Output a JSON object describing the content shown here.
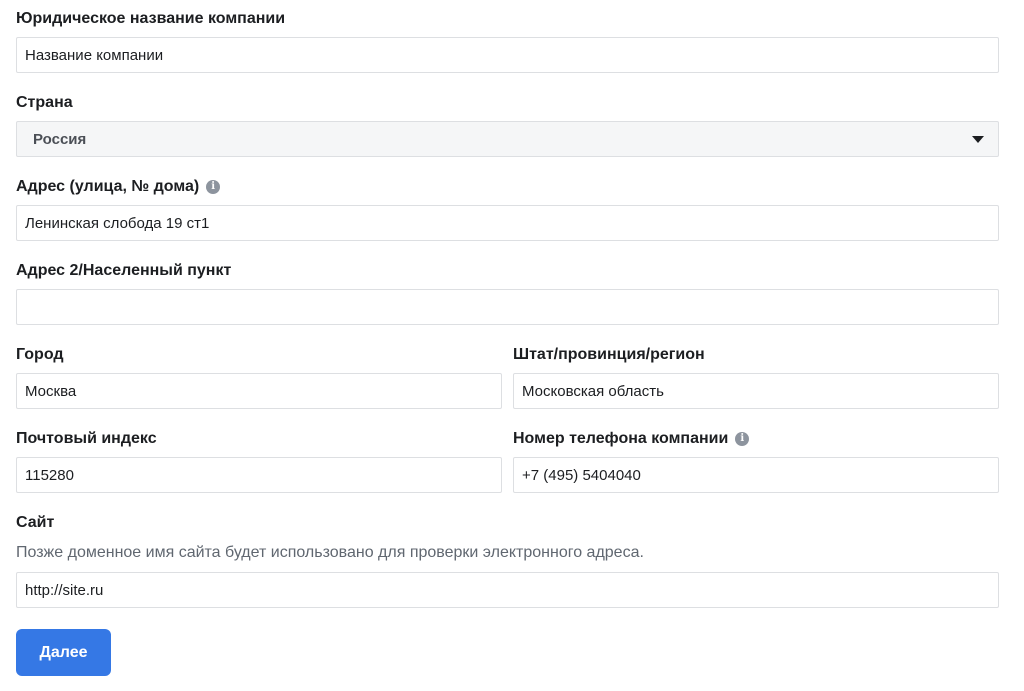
{
  "company_name": {
    "label": "Юридическое название компании",
    "value": "Название компании"
  },
  "country": {
    "label": "Страна",
    "selected": "Россия"
  },
  "address1": {
    "label": "Адрес (улица, № дома)",
    "value": "Ленинская слобода 19 ст1",
    "info_icon": "info-icon"
  },
  "address2": {
    "label": "Адрес 2/Населенный пункт",
    "value": ""
  },
  "city": {
    "label": "Город",
    "value": "Москва"
  },
  "region": {
    "label": "Штат/провинция/регион",
    "value": "Московская область"
  },
  "postal": {
    "label": "Почтовый индекс",
    "value": "115280"
  },
  "phone": {
    "label": "Номер телефона компании",
    "value": "+7 (495) 5404040",
    "info_icon": "info-icon"
  },
  "website": {
    "label": "Сайт",
    "hint": "Позже доменное имя сайта будет использовано для проверки электронного адреса.",
    "value": "http://site.ru"
  },
  "next_button": {
    "label": "Далее",
    "color": "#3578e5"
  }
}
